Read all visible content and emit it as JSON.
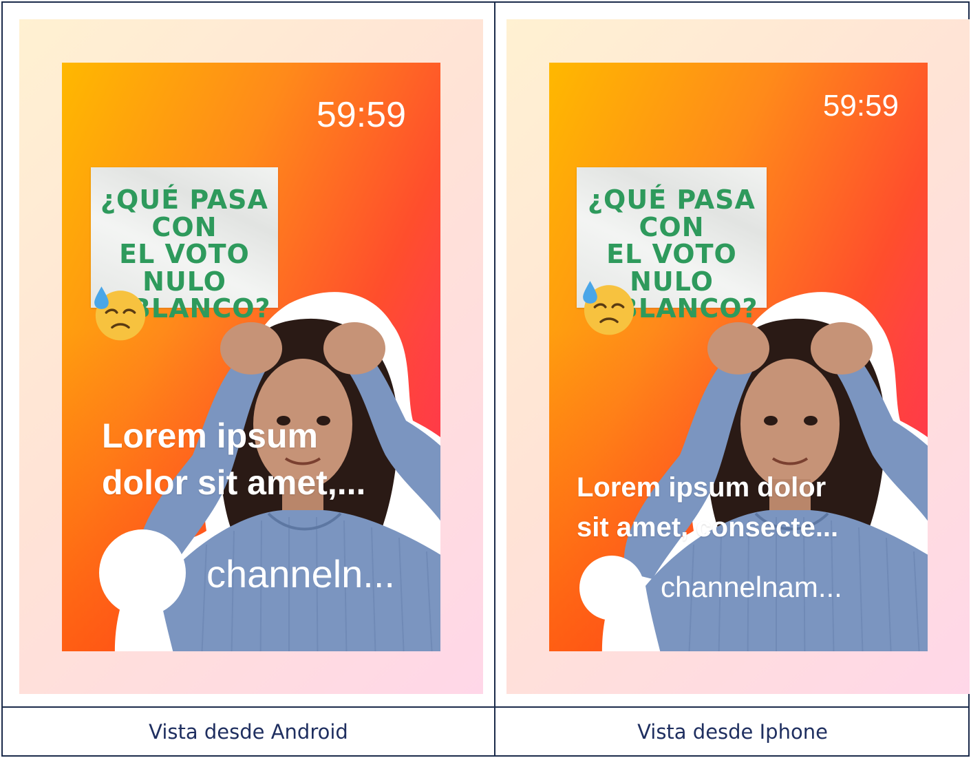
{
  "panels": [
    {
      "timer": "59:59",
      "note": {
        "line1": "¿QUÉ PASA CON",
        "line2": "EL VOTO NULO",
        "line3": "O BLANCO?"
      },
      "headline": {
        "line1": "Lorem ipsum",
        "line2": "dolor sit amet,..."
      },
      "channel": "channeln...",
      "caption": "Vista desde Android"
    },
    {
      "timer": "59:59",
      "note": {
        "line1": "¿QUÉ PASA CON",
        "line2": "EL VOTO NULO",
        "line3": "O BLANCO?"
      },
      "headline": {
        "line1": "Lorem ipsum dolor",
        "line2": "sit amet, consecte..."
      },
      "channel": "channelnam...",
      "caption": "Vista desde Iphone"
    }
  ],
  "colors": {
    "border": "#1a2a4a",
    "caption_text": "#1f2f60",
    "note_text": "#2e9a5c",
    "sweater": "#7b95c0"
  }
}
